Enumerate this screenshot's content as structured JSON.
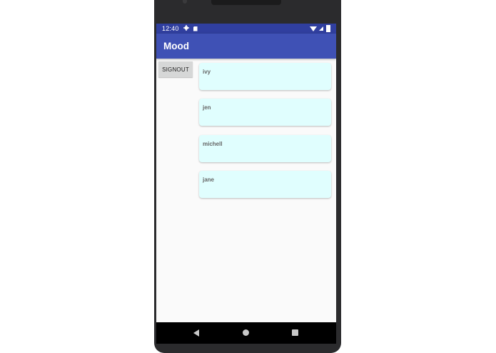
{
  "status_bar": {
    "time": "12:40",
    "left_icons": [
      "gear-icon",
      "sd-card-icon"
    ],
    "right_icons": [
      "wifi-icon",
      "cell-signal-icon",
      "battery-icon"
    ]
  },
  "app_bar": {
    "title": "Mood",
    "color": "#3f51b5",
    "status_color": "#303f9f"
  },
  "signout_button": {
    "label": "SIGNOUT"
  },
  "cards": [
    {
      "name": "ivy"
    },
    {
      "name": "jen"
    },
    {
      "name": "michell"
    },
    {
      "name": "jane"
    }
  ],
  "card_color": "#e0fefe",
  "nav_bar": {
    "buttons": [
      "back-icon",
      "home-icon",
      "recents-icon"
    ]
  }
}
